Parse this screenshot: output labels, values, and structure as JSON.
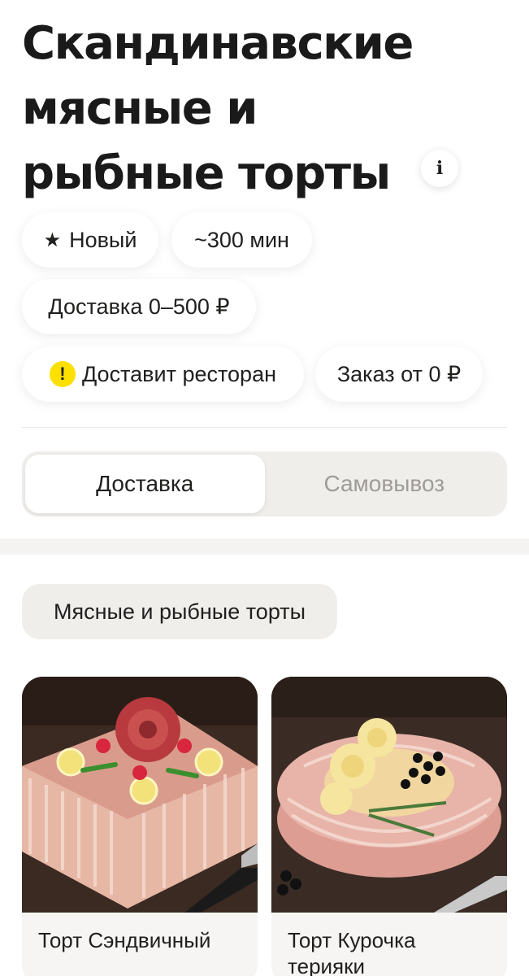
{
  "header": {
    "title_lines": [
      "Скандинавские",
      "мясные и",
      "рыбные торты"
    ],
    "info_icon": "info-icon"
  },
  "chips": {
    "rating": {
      "icon": "star-icon",
      "label": "Новый"
    },
    "time": {
      "label": "~300 мин"
    },
    "delivery_price": {
      "label": "Доставка 0–500 ₽"
    },
    "courier": {
      "icon": "exclamation-icon",
      "label": "Доставит ресторан"
    },
    "min_order": {
      "label": "Заказ от 0 ₽"
    }
  },
  "mode_switch": {
    "options": [
      "Доставка",
      "Самовывоз"
    ],
    "selected": "Доставка"
  },
  "category": {
    "label": "Мясные и рыбные торты"
  },
  "products": [
    {
      "name": "Торт Сэндвичный"
    },
    {
      "name": "Торт Курочка терияки"
    }
  ],
  "colors": {
    "accent_yellow": "#fce000",
    "chip_bg": "#f0eeeb",
    "text": "#21201f",
    "muted": "#9e9b98"
  }
}
